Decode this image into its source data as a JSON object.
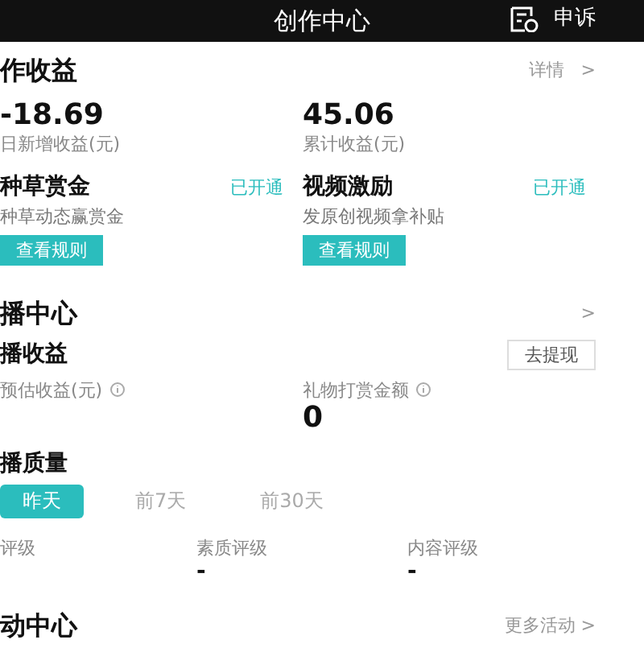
{
  "header": {
    "title": "创作中心",
    "action": "申诉"
  },
  "earnings": {
    "title": "作收益",
    "link": "详情",
    "arrow": ">",
    "stats": [
      {
        "value": "-18.69",
        "label": "日新增收益(元)"
      },
      {
        "value": "45.06",
        "label": "累计收益(元)"
      }
    ],
    "cards": [
      {
        "title": "种草赏金",
        "status": "已开通",
        "desc": "种草动态赢赏金",
        "button": "查看规则"
      },
      {
        "title": "视频激励",
        "status": "已开通",
        "desc": "发原创视频拿补贴",
        "button": "查看规则"
      }
    ]
  },
  "live": {
    "title": "播中心",
    "arrow": ">",
    "income_title": "播收益",
    "withdraw": "去提现",
    "stats": [
      {
        "label": "预估收益(元)"
      },
      {
        "label": "礼物打赏金额",
        "value": "0"
      }
    ]
  },
  "quality": {
    "title": "播质量",
    "tabs": [
      {
        "label": "昨天",
        "selected": true
      },
      {
        "label": "前7天",
        "selected": false
      },
      {
        "label": "前30天",
        "selected": false
      }
    ],
    "ratings": [
      {
        "label": "评级"
      },
      {
        "label": "素质评级",
        "value": "-"
      },
      {
        "label": "内容评级",
        "value": "-"
      }
    ]
  },
  "activity": {
    "title": "动中心",
    "link": "更多活动 >"
  }
}
